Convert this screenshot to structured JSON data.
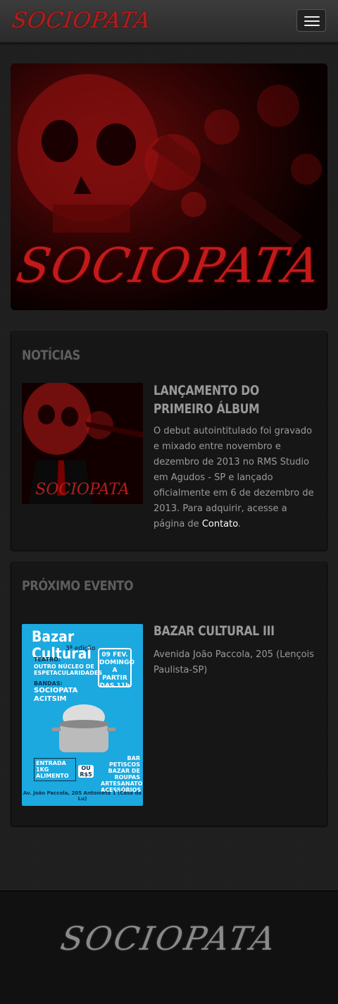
{
  "header": {
    "brand": "SOCIOPATA",
    "menu_icon": "hamburger-icon"
  },
  "hero": {
    "title": "SOCIOPATA",
    "accent_color": "#c21a1a"
  },
  "news": {
    "heading": "NOTÍCIAS",
    "item": {
      "title": "Lançamento do primeiro álbum",
      "text": "O debut autointitulado foi gravado e mixado entre novembro e dezembro de 2013 no RMS Studio em Agudos - SP e lançado oficialmente em 6 de dezembro de 2013. Para adquirir, acesse a página de ",
      "link": "Contato",
      "text_end": ".",
      "cover_logo": "SOCIOPATA"
    }
  },
  "event": {
    "heading": "PRÓXIMO EVENTO",
    "item": {
      "title": "Bazar Cultural III",
      "text": "Avenida João Paccola, 205 (Lençois Paulista-SP)",
      "poster": {
        "title": "Bazar Cultural",
        "edition": "3ª edição",
        "date": "09 FEV. DOMINGO A PARTIR DAS 11h",
        "teatro_label": "TEATRO:",
        "teatro": "OUTRO NÚCLEO DE ESPETACULARIDADES",
        "bandas_label": "BANDAS:",
        "band1": "SOCIOPATA",
        "band2": "ACITSIM",
        "entrada": "ENTRADA 1KG ALIMENTO",
        "ou": "OU R$5",
        "extras": "BAR PETISCOS BAZAR DE ROUPAS ARTESANATO ACESSÓRIOS",
        "address": "Av. João Paccola, 205 Antonieta 1 (Casa da Lu)",
        "bg_color": "#1ba9e0"
      }
    }
  },
  "footer": {
    "logo": "SOCIOPATA"
  }
}
